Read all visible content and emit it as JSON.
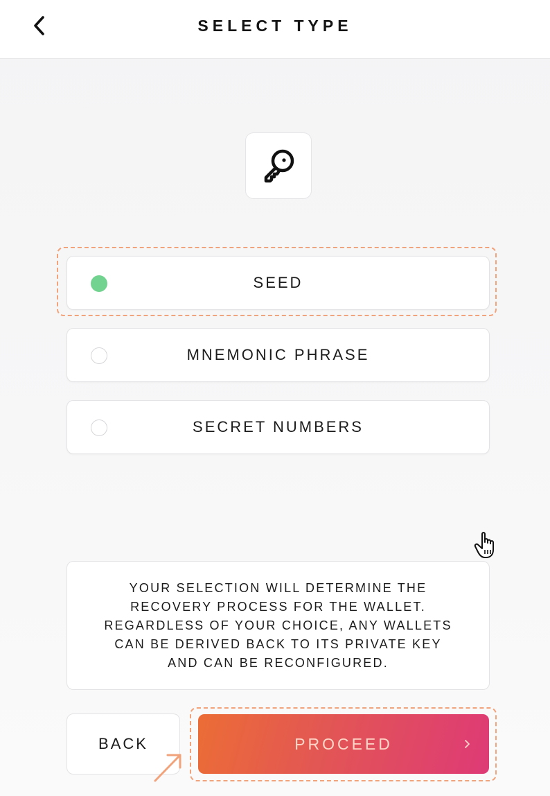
{
  "header": {
    "title": "SELECT TYPE",
    "back_icon": "chevron-left-icon"
  },
  "hero": {
    "icon": "key-icon"
  },
  "options": [
    {
      "label": "SEED",
      "selected": true
    },
    {
      "label": "MNEMONIC PHRASE",
      "selected": false
    },
    {
      "label": "SECRET NUMBERS",
      "selected": false
    }
  ],
  "info": {
    "lines": [
      "YOUR SELECTION WILL DETERMINE THE",
      "RECOVERY PROCESS FOR THE WALLET.",
      "REGARDLESS OF YOUR CHOICE, ANY WALLETS",
      "CAN BE DERIVED BACK TO ITS PRIVATE KEY",
      "AND CAN BE RECONFIGURED."
    ]
  },
  "footer": {
    "back_label": "BACK",
    "proceed_label": "PROCEED",
    "proceed_icon": "chevron-right-icon"
  },
  "colors": {
    "selected_radio": "#72d28f",
    "highlight_dash": "#f1a37c",
    "proceed_gradient_start": "#ec6d36",
    "proceed_gradient_end": "#de3a76"
  }
}
